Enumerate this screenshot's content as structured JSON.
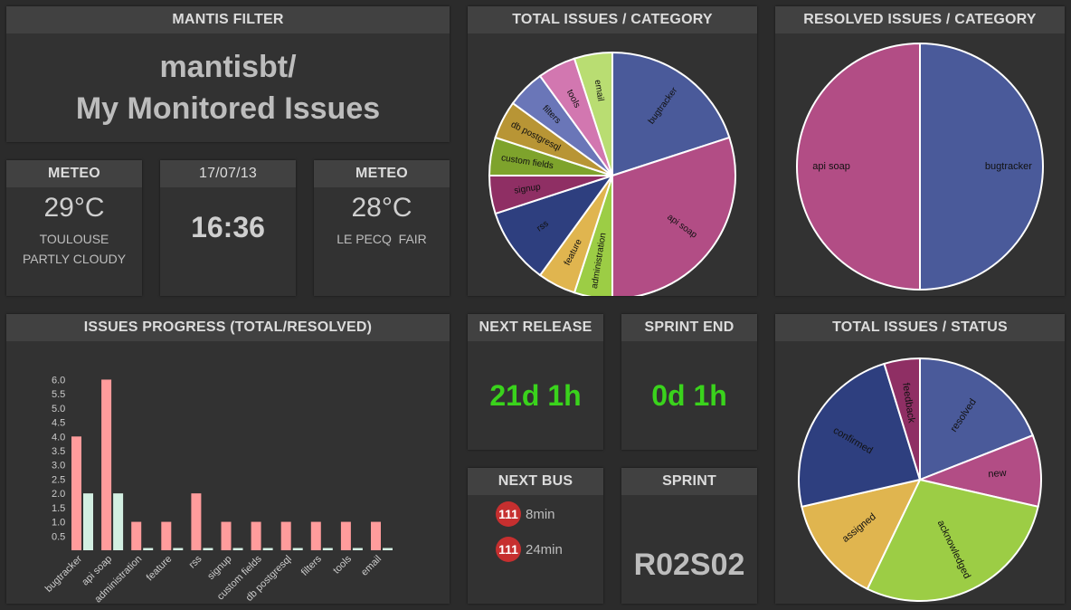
{
  "filter": {
    "header": "MANTIS FILTER",
    "line1": "mantisbt/",
    "line2": "My Monitored Issues"
  },
  "meteo1": {
    "header": "METEO",
    "temp": "29°C",
    "city": "TOULOUSE",
    "condition": "PARTLY CLOUDY"
  },
  "clock": {
    "date": "17/07/13",
    "time": "16:36"
  },
  "meteo2": {
    "header": "METEO",
    "temp": "28°C",
    "city": "LE PECQ  FAIR"
  },
  "total_category": {
    "header": "TOTAL ISSUES / CATEGORY",
    "slices": [
      {
        "label": "bugtracker",
        "value": 4,
        "color": "#4a5a9a"
      },
      {
        "label": "api soap",
        "value": 6,
        "color": "#b24d85"
      },
      {
        "label": "administration",
        "value": 1,
        "color": "#9ccd45"
      },
      {
        "label": "feature",
        "value": 1,
        "color": "#e0b54f"
      },
      {
        "label": "rss",
        "value": 2,
        "color": "#2e3f7f"
      },
      {
        "label": "signup",
        "value": 1,
        "color": "#8f2f64"
      },
      {
        "label": "custom fields",
        "value": 1,
        "color": "#7ea32c"
      },
      {
        "label": "db postgresql",
        "value": 1,
        "color": "#b89535"
      },
      {
        "label": "filters",
        "value": 1,
        "color": "#6a76b8"
      },
      {
        "label": "tools",
        "value": 1,
        "color": "#d277b0"
      },
      {
        "label": "email",
        "value": 1,
        "color": "#b9dd72"
      }
    ]
  },
  "resolved_category": {
    "header": "RESOLVED ISSUES / CATEGORY",
    "slices": [
      {
        "label": "bugtracker",
        "value": 2,
        "color": "#4a5a9a"
      },
      {
        "label": "api soap",
        "value": 2,
        "color": "#b24d85"
      }
    ]
  },
  "progress": {
    "header": "ISSUES PROGRESS (TOTAL/RESOLVED)"
  },
  "next_release": {
    "header": "NEXT RELEASE",
    "value": "21d 1h"
  },
  "sprint_end": {
    "header": "SPRINT END",
    "value": "0d 1h"
  },
  "status": {
    "header": "TOTAL ISSUES / STATUS",
    "slices": [
      {
        "label": "resolved",
        "value": 4,
        "color": "#4a5a9a"
      },
      {
        "label": "new",
        "value": 2,
        "color": "#b24d85"
      },
      {
        "label": "acknowledged",
        "value": 6,
        "color": "#9ccd45"
      },
      {
        "label": "assigned",
        "value": 3,
        "color": "#e0b54f"
      },
      {
        "label": "confirmed",
        "value": 5,
        "color": "#2e3f7f"
      },
      {
        "label": "feedback",
        "value": 1,
        "color": "#8f2f64"
      }
    ]
  },
  "next_bus": {
    "header": "NEXT BUS",
    "buses": [
      {
        "line": "111",
        "time": "8min"
      },
      {
        "line": "111",
        "time": "24min"
      }
    ]
  },
  "sprint": {
    "header": "SPRINT",
    "value": "R02S02"
  },
  "chart_data": {
    "type": "bar",
    "title": "ISSUES PROGRESS (TOTAL/RESOLVED)",
    "categories": [
      "bugtracker",
      "api soap",
      "administration",
      "feature",
      "rss",
      "signup",
      "custom fields",
      "db postgresql",
      "filters",
      "tools",
      "email"
    ],
    "series": [
      {
        "values": [
          4,
          6,
          1,
          1,
          2,
          1,
          1,
          1,
          1,
          1,
          1
        ],
        "color": "#ff9c9c"
      },
      {
        "values": [
          2,
          2,
          0,
          0,
          0,
          0,
          0,
          0,
          0,
          0,
          0
        ],
        "color": "#d3efe2"
      }
    ],
    "ylim": [
      0,
      6.3
    ],
    "yticks": [
      "0.5",
      "1.0",
      "1.5",
      "2.0",
      "2.5",
      "3.0",
      "3.5",
      "4.0",
      "4.5",
      "5.0",
      "5.5",
      "6.0"
    ],
    "xlabel": "",
    "ylabel": "",
    "grid": false
  }
}
